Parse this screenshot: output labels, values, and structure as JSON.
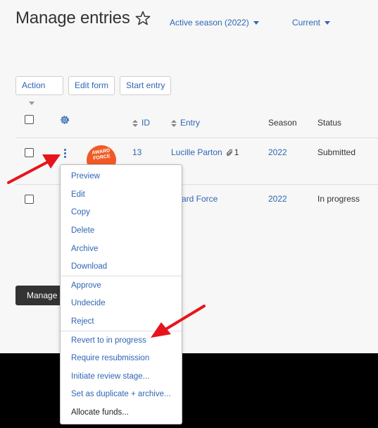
{
  "page": {
    "title": "Manage entries",
    "season_filter": "Active season (2022)",
    "status_filter": "Current"
  },
  "toolbar": {
    "action_label": "Action",
    "edit_form_label": "Edit form",
    "start_entry_label": "Start entry"
  },
  "table": {
    "columns": {
      "id": "ID",
      "entry": "Entry",
      "season": "Season",
      "status": "Status"
    },
    "rows": [
      {
        "id": "13",
        "entry": "Lucille Parton",
        "attachments": "1",
        "season": "2022",
        "status": "Submitted",
        "avatar_text": "AWARD FORCE"
      },
      {
        "entry_partial": "ard Force",
        "season": "2022",
        "status": "In progress"
      }
    ]
  },
  "manage_button": "Manage",
  "context_menu": {
    "group1": [
      "Preview",
      "Edit",
      "Copy",
      "Delete",
      "Archive",
      "Download"
    ],
    "group2": [
      "Approve",
      "Undecide",
      "Reject"
    ],
    "group3": [
      "Revert to in progress",
      "Require resubmission",
      "Initiate review stage...",
      "Set as duplicate + archive...",
      "Allocate funds..."
    ]
  },
  "colors": {
    "link": "#2f66b3",
    "background": "#f7f7f7",
    "annotation_arrow": "#e8141b",
    "avatar": "#f15a24"
  }
}
